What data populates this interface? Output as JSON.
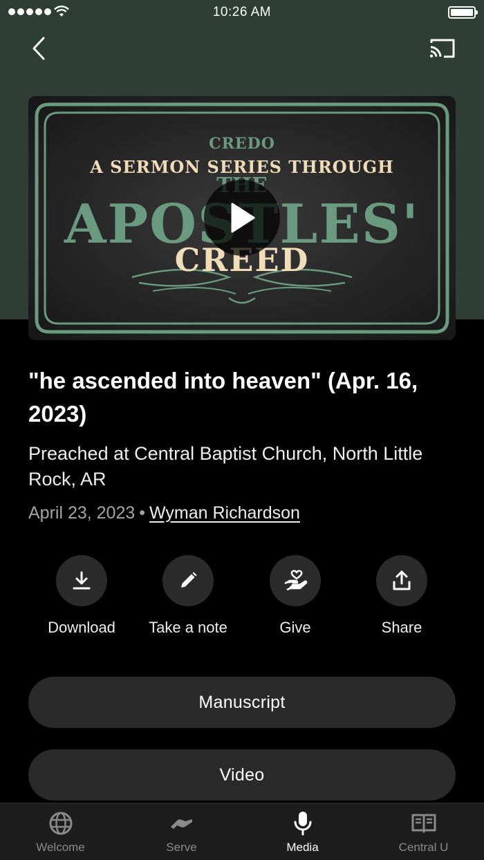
{
  "status_bar": {
    "time": "10:26 AM"
  },
  "artwork": {
    "credo": "CREDO",
    "series": "A SERMON SERIES THROUGH",
    "the": "THE",
    "apostles": "APOSTLES'",
    "creed": "CREED"
  },
  "sermon": {
    "title": "\"he ascended into heaven\" (Apr. 16, 2023)",
    "subtitle": "Preached at Central Baptist Church, North Little Rock, AR",
    "date": "April 23, 2023",
    "separator": "•",
    "author": "Wyman Richardson"
  },
  "actions": [
    {
      "label": "Download",
      "icon": "download-icon"
    },
    {
      "label": "Take a note",
      "icon": "pencil-icon"
    },
    {
      "label": "Give",
      "icon": "give-heart-hand-icon"
    },
    {
      "label": "Share",
      "icon": "share-icon"
    }
  ],
  "buttons": {
    "manuscript": "Manuscript",
    "video": "Video"
  },
  "tabs": [
    {
      "label": "Welcome",
      "icon": "globe-icon",
      "active": false
    },
    {
      "label": "Serve",
      "icon": "handshake-icon",
      "active": false
    },
    {
      "label": "Media",
      "icon": "microphone-icon",
      "active": true
    },
    {
      "label": "Central U",
      "icon": "book-icon",
      "active": false
    }
  ],
  "colors": {
    "header_bg": "#2e3e35",
    "background": "#000000",
    "accent_green": "#6a9a80",
    "accent_cream": "#f0dcb8"
  }
}
